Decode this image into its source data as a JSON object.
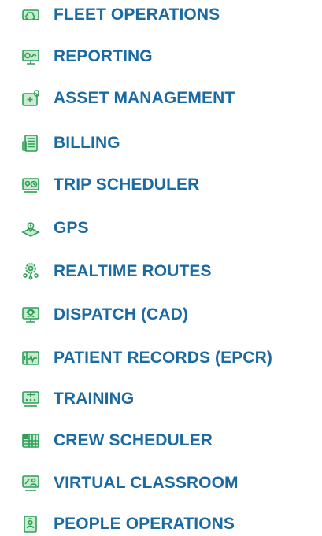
{
  "menu": {
    "items": [
      {
        "label": "FLEET OPERATIONS",
        "icon": "truck-icon"
      },
      {
        "label": "REPORTING",
        "icon": "chart-monitor-icon"
      },
      {
        "label": "ASSET MANAGEMENT",
        "icon": "asset-box-icon"
      },
      {
        "label": "BILLING",
        "icon": "billing-ledger-icon"
      },
      {
        "label": "TRIP SCHEDULER",
        "icon": "trip-clock-icon"
      },
      {
        "label": "GPS",
        "icon": "map-pin-icon"
      },
      {
        "label": "REALTIME ROUTES",
        "icon": "route-gear-icon"
      },
      {
        "label": "DISPATCH (CAD)",
        "icon": "dispatch-headset-icon"
      },
      {
        "label": "PATIENT RECORDS (EPCR)",
        "icon": "heartbeat-monitor-icon"
      },
      {
        "label": "TRAINING",
        "icon": "training-board-icon"
      },
      {
        "label": "CREW SCHEDULER",
        "icon": "crew-calendar-icon"
      },
      {
        "label": "VIRTUAL CLASSROOM",
        "icon": "virtual-class-icon"
      },
      {
        "label": "PEOPLE OPERATIONS",
        "icon": "id-badge-icon"
      }
    ]
  },
  "colors": {
    "label": "#1b6aa2",
    "icon": "#2f9e57",
    "icon_fill": "#c9ebd2"
  }
}
